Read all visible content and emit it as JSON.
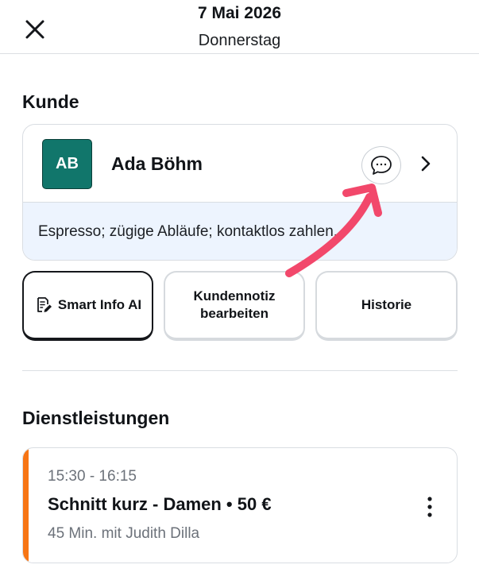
{
  "header": {
    "date": "7 Mai 2026",
    "weekday": "Donnerstag",
    "close_icon": "close-icon"
  },
  "customer_section": {
    "title": "Kunde",
    "avatar_initials": "AB",
    "avatar_color": "#11766b",
    "name": "Ada Böhm",
    "note": "Espresso; zügige Abläufe; kontaktlos zahlen.",
    "note_bg": "#edf4fe",
    "chat_icon": "chat-bubble-icon",
    "chevron_icon": "chevron-right-icon"
  },
  "actions": {
    "smart_info": "Smart Info AI",
    "smart_info_icon": "ai-note-icon",
    "edit_note_line1": "Kundennotiz",
    "edit_note_line2": "bearbeiten",
    "history": "Historie"
  },
  "services_section": {
    "title": "Dienstleistungen",
    "items": [
      {
        "time": "15:30 - 16:15",
        "title": "Schnitt kurz - Damen • 50 €",
        "meta": "45 Min. mit Judith Dilla",
        "accent": "#f77514",
        "menu_icon": "more-vertical-icon"
      }
    ]
  },
  "annotation": {
    "color": "#f2486b",
    "icon": "curved-arrow-icon"
  }
}
